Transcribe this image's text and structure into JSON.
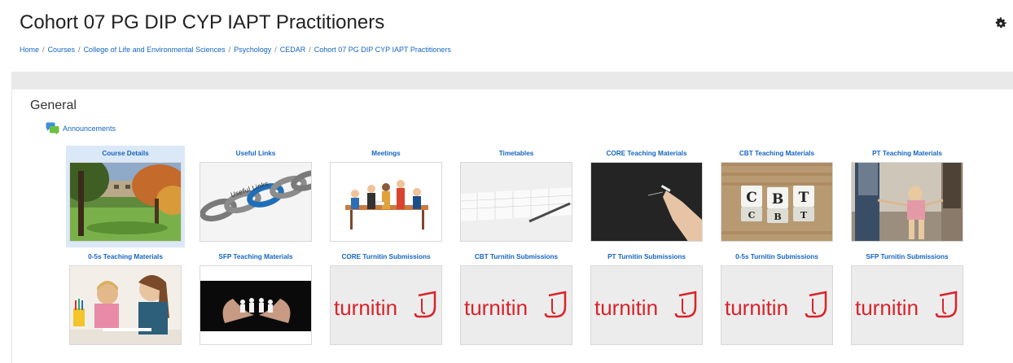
{
  "header": {
    "title": "Cohort 07 PG DIP CYP IAPT Practitioners",
    "settings_icon": "gear-icon",
    "breadcrumb": [
      "Home",
      "Courses",
      "College of Life and Environmental Sciences",
      "Psychology",
      "CEDAR",
      "Cohort 07 PG DIP CYP IAPT Practitioners"
    ],
    "breadcrumb_separator": "/"
  },
  "section": {
    "title": "General",
    "announcements": {
      "label": "Announcements",
      "icon": "forum-icon"
    }
  },
  "tiles": [
    {
      "label": "Course Details",
      "image": "campus-trees-photo",
      "selected": true
    },
    {
      "label": "Useful Links",
      "image": "chain-links-photo"
    },
    {
      "label": "Meetings",
      "image": "meeting-people-illustration"
    },
    {
      "label": "Timetables",
      "image": "calendar-pen-photo"
    },
    {
      "label": "CORE Teaching Materials",
      "image": "chalkboard-hand-photo"
    },
    {
      "label": "CBT Teaching Materials",
      "image": "cbt-letter-cubes-photo"
    },
    {
      "label": "PT Teaching Materials",
      "image": "parents-child-walking-photo"
    },
    {
      "label": "0-5s Teaching Materials",
      "image": "mother-child-drawing-photo"
    },
    {
      "label": "SFP Teaching Materials",
      "image": "hands-paper-family-photo"
    },
    {
      "label": "CORE Turnitin Submissions",
      "image": "turnitin-logo",
      "logo_text": "turnitin"
    },
    {
      "label": "CBT Turnitin Submissions",
      "image": "turnitin-logo",
      "logo_text": "turnitin"
    },
    {
      "label": "PT Turnitin Submissions",
      "image": "turnitin-logo",
      "logo_text": "turnitin"
    },
    {
      "label": "0-5s Turnitin Submissions",
      "image": "turnitin-logo",
      "logo_text": "turnitin"
    },
    {
      "label": "SFP Turnitin Submissions",
      "image": "turnitin-logo",
      "logo_text": "turnitin"
    }
  ],
  "colors": {
    "link": "#1565c0",
    "selected_tile": "#dbe8f7",
    "turnitin_red": "#d8232a",
    "turnitin_grey": "#8a8a8a"
  },
  "cbt_cube_letters": [
    "C",
    "B",
    "T",
    "C",
    "B",
    "T"
  ],
  "useful_links_caption": "Useful Links"
}
